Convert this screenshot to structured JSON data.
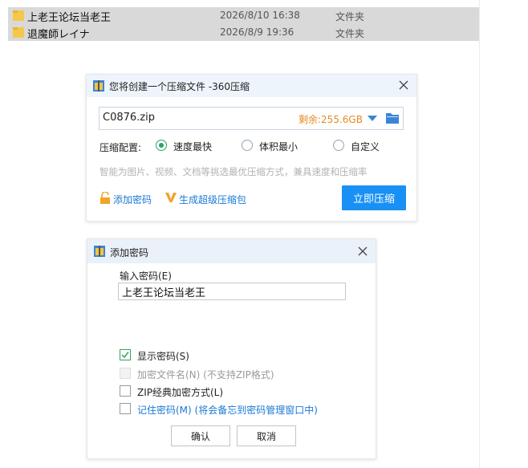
{
  "files": [
    {
      "name": "上老王论坛当老王",
      "date": "2026/8/10 16:38",
      "type": "文件夹"
    },
    {
      "name": "退魔師レイナ",
      "date": "2026/8/9 19:36",
      "type": "文件夹"
    }
  ],
  "compress_dialog": {
    "title": "您将创建一个压缩文件 -360压缩",
    "filename": "C0876.zip",
    "remaining": "剩余:255.6GB",
    "config_label": "压缩配置:",
    "options": [
      "速度最快",
      "体积最小",
      "自定义"
    ],
    "selected_option": "速度最快",
    "hint": "智能为图片、视频、文档等挑选最优压缩方式，兼具速度和压缩率",
    "add_password_link": "添加密码",
    "super_pack_link": "生成超级压缩包",
    "compress_button": "立即压缩"
  },
  "password_dialog": {
    "title": "添加密码",
    "input_label": "输入密码(E)",
    "password_value": "上老王论坛当老王",
    "checkboxes": [
      {
        "label": "显示密码(S)",
        "checked": true,
        "disabled": false
      },
      {
        "label": "加密文件名(N) (不支持ZIP格式)",
        "checked": false,
        "disabled": true
      },
      {
        "label": "ZIP经典加密方式(L)",
        "checked": false,
        "disabled": false
      },
      {
        "label": "记住密码(M) (将会备忘到密码管理窗口中)",
        "checked": false,
        "disabled": false
      }
    ],
    "ok_button": "确认",
    "cancel_button": "取消"
  },
  "colors": {
    "accent": "#1890f5",
    "remaining_text": "#e58a1f",
    "radio_selected": "#2aa36b",
    "link": "#1a79d4"
  }
}
